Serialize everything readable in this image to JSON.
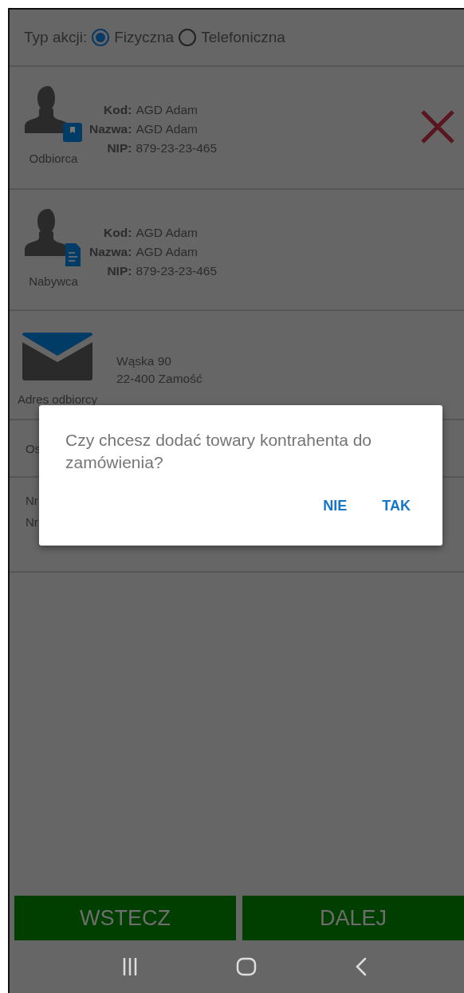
{
  "action_type": {
    "label": "Typ akcji:",
    "options": [
      {
        "label": "Fizyczna",
        "selected": true
      },
      {
        "label": "Telefoniczna",
        "selected": false
      }
    ]
  },
  "parties": [
    {
      "kind": "bookmark",
      "role": "Odbiorca",
      "removable": true,
      "fields": [
        {
          "label": "Kod:",
          "value": "AGD Adam"
        },
        {
          "label": "Nazwa:",
          "value": "AGD Adam"
        },
        {
          "label": "NIP:",
          "value": "879-23-23-465"
        }
      ]
    },
    {
      "kind": "document",
      "role": "Nabywca",
      "removable": false,
      "fields": [
        {
          "label": "Kod:",
          "value": "AGD Adam"
        },
        {
          "label": "Nazwa:",
          "value": "AGD Adam"
        },
        {
          "label": "NIP:",
          "value": "879-23-23-465"
        }
      ]
    }
  ],
  "address": {
    "label": "Adres odbiorcy",
    "lines": [
      "Wąska 90",
      "22-400 Zamość"
    ]
  },
  "covered_rows": [
    {
      "text": "Os"
    },
    {
      "text": "Nr"
    },
    {
      "text": "Nr"
    }
  ],
  "buttons": [
    "WSTECZ",
    "DALEJ"
  ],
  "dialog": {
    "message": "Czy chcesz dodać towary kontrahenta do zamówienia?",
    "actions": [
      "NIE",
      "TAK"
    ]
  }
}
